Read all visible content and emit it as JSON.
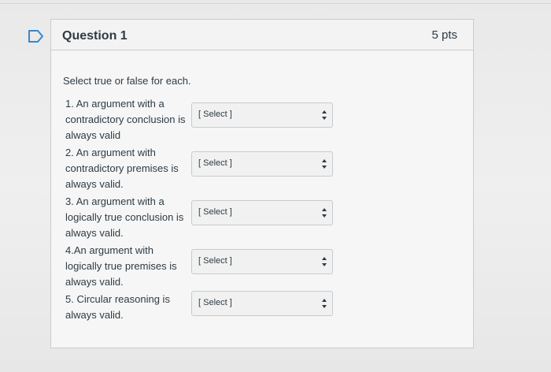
{
  "question": {
    "title": "Question 1",
    "points": "5 pts",
    "instructions": "Select true or false for each."
  },
  "items": [
    {
      "lines": [
        "1. An argument with a",
        "contradictory conclusion is",
        "always valid"
      ],
      "select": "[ Select ]"
    },
    {
      "lines": [
        "2. An argument with",
        "contradictory premises is",
        "always valid."
      ],
      "select": "[ Select ]"
    },
    {
      "lines": [
        "3. An argument with a",
        "logically true conclusion is",
        "always valid."
      ],
      "select": "[ Select ]"
    },
    {
      "lines": [
        "4.An argument with",
        "logically true premises is",
        "always valid."
      ],
      "select": "[ Select ]"
    },
    {
      "lines": [
        "5. Circular reasoning is",
        "always valid."
      ],
      "select": "[ Select ]"
    }
  ],
  "icons": {
    "flag": "flag-icon",
    "select_arrow": "up-down-arrows-icon"
  }
}
